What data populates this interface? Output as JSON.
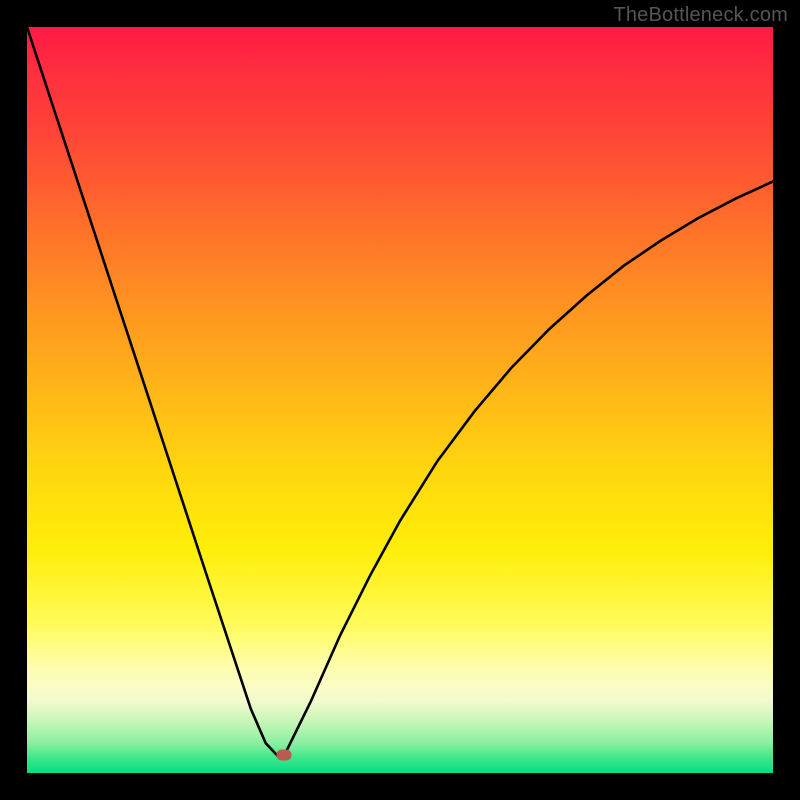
{
  "watermark": "TheBottleneck.com",
  "dot": {
    "x_frac": 0.345,
    "y_frac": 0.976
  },
  "colors": {
    "frame": "#000000",
    "curve": "#000000",
    "dot": "#bb5a4e",
    "watermark": "#555555"
  },
  "chart_data": {
    "type": "line",
    "title": "",
    "xlabel": "",
    "ylabel": "",
    "xlim": [
      0,
      1
    ],
    "ylim": [
      0,
      1
    ],
    "annotations": [
      "TheBottleneck.com"
    ],
    "marker": {
      "x": 0.345,
      "y": 0.024
    },
    "series": [
      {
        "name": "left",
        "x": [
          0.0,
          0.04,
          0.08,
          0.12,
          0.16,
          0.2,
          0.24,
          0.27,
          0.3,
          0.32,
          0.335
        ],
        "y": [
          1.0,
          0.878,
          0.756,
          0.634,
          0.512,
          0.39,
          0.268,
          0.177,
          0.086,
          0.04,
          0.024
        ]
      },
      {
        "name": "right",
        "x": [
          0.345,
          0.38,
          0.42,
          0.46,
          0.5,
          0.55,
          0.6,
          0.65,
          0.7,
          0.75,
          0.8,
          0.85,
          0.9,
          0.95,
          1.0
        ],
        "y": [
          0.024,
          0.095,
          0.185,
          0.265,
          0.338,
          0.418,
          0.485,
          0.544,
          0.595,
          0.64,
          0.68,
          0.714,
          0.744,
          0.77,
          0.793
        ]
      }
    ]
  }
}
